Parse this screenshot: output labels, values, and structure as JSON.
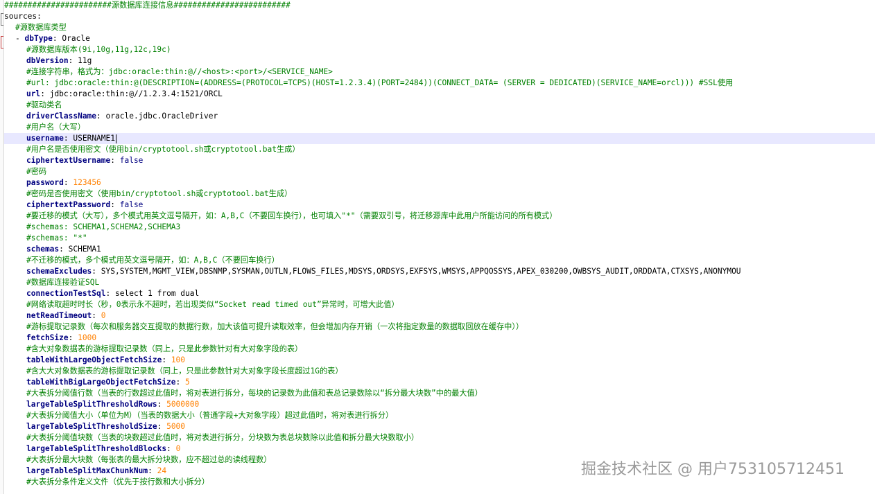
{
  "editor": {
    "lines": [
      {
        "type": "comment",
        "indent": 0,
        "text": "#######################源数据库连接信息#########################"
      },
      {
        "type": "kv",
        "indent": 0,
        "key": "sources",
        "val": "",
        "keyStyle": "plain"
      },
      {
        "type": "comment",
        "indent": 1,
        "text": "#源数据库类型"
      },
      {
        "type": "kv",
        "indent": 1,
        "dash": true,
        "key": "dbType",
        "val": "Oracle",
        "keyStyle": "bold"
      },
      {
        "type": "comment",
        "indent": 2,
        "text": "#源数据库版本(9i,10g,11g,12c,19c)"
      },
      {
        "type": "kv",
        "indent": 2,
        "key": "dbVersion",
        "val": "11g",
        "keyStyle": "bold"
      },
      {
        "type": "comment",
        "indent": 2,
        "text": "#连接字符串，格式为：jdbc:oracle:thin:@//<host>:<port>/<SERVICE_NAME>"
      },
      {
        "type": "comment",
        "indent": 2,
        "text": "#url: jdbc:oracle:thin:@(DESCRIPTION=(ADDRESS=(PROTOCOL=TCPS)(HOST=1.2.3.4)(PORT=2484))(CONNECT_DATA= (SERVER = DEDICATED)(SERVICE_NAME=orcl))) #SSL使用"
      },
      {
        "type": "kv",
        "indent": 2,
        "key": "url",
        "val": "jdbc:oracle:thin:@//1.2.3.4:1521/ORCL",
        "keyStyle": "bold"
      },
      {
        "type": "comment",
        "indent": 2,
        "text": "#驱动类名"
      },
      {
        "type": "kv",
        "indent": 2,
        "key": "driverClassName",
        "val": "oracle.jdbc.OracleDriver",
        "keyStyle": "bold"
      },
      {
        "type": "comment",
        "indent": 2,
        "text": "#用户名（大写）"
      },
      {
        "type": "kv",
        "indent": 2,
        "key": "username",
        "val": "USERNAME1",
        "keyStyle": "bold",
        "current": true
      },
      {
        "type": "comment",
        "indent": 2,
        "text": "#用户名是否使用密文（使用bin/cryptotool.sh或cryptotool.bat生成）"
      },
      {
        "type": "kv",
        "indent": 2,
        "key": "ciphertextUsername",
        "val": "false",
        "keyStyle": "bold",
        "valStyle": "bool"
      },
      {
        "type": "comment",
        "indent": 2,
        "text": "#密码"
      },
      {
        "type": "kv",
        "indent": 2,
        "key": "password",
        "val": "123456",
        "keyStyle": "bold",
        "valStyle": "num"
      },
      {
        "type": "comment",
        "indent": 2,
        "text": "#密码是否使用密文（使用bin/cryptotool.sh或cryptotool.bat生成）"
      },
      {
        "type": "kv",
        "indent": 2,
        "key": "ciphertextPassword",
        "val": "false",
        "keyStyle": "bold",
        "valStyle": "bool"
      },
      {
        "type": "comment",
        "indent": 2,
        "text": "#要迁移的模式（大写），多个模式用英文逗号隔开，如：A,B,C（不要回车换行），也可填入\"*\"（需要双引号，将迁移源库中此用户所能访问的所有模式）"
      },
      {
        "type": "comment",
        "indent": 2,
        "text": "#schemas: SCHEMA1,SCHEMA2,SCHEMA3"
      },
      {
        "type": "comment",
        "indent": 2,
        "text": "#schemas: \"*\""
      },
      {
        "type": "kv",
        "indent": 2,
        "key": "schemas",
        "val": "SCHEMA1",
        "keyStyle": "bold"
      },
      {
        "type": "comment",
        "indent": 2,
        "text": "#不迁移的模式，多个模式用英文逗号隔开，如：A,B,C（不要回车换行）"
      },
      {
        "type": "kv",
        "indent": 2,
        "key": "schemaExcludes",
        "val": "SYS,SYSTEM,MGMT_VIEW,DBSNMP,SYSMAN,OUTLN,FLOWS_FILES,MDSYS,ORDSYS,EXFSYS,WMSYS,APPQOSSYS,APEX_030200,OWBSYS_AUDIT,ORDDATA,CTXSYS,ANONYMOU",
        "keyStyle": "bold"
      },
      {
        "type": "comment",
        "indent": 2,
        "text": "#数据库连接验证SQL"
      },
      {
        "type": "kv",
        "indent": 2,
        "key": "connectionTestSql",
        "val": "select 1 from dual",
        "keyStyle": "bold"
      },
      {
        "type": "comment",
        "indent": 2,
        "text": "#网络读取超时时长（秒，0表示永不超时，若出现类似“Socket read timed out”异常时，可增大此值）"
      },
      {
        "type": "kv",
        "indent": 2,
        "key": "netReadTimeout",
        "val": "0",
        "keyStyle": "bold",
        "valStyle": "num"
      },
      {
        "type": "comment",
        "indent": 2,
        "text": "#游标提取记录数（每次和服务器交互提取的数据行数，加大该值可提升读取效率，但会增加内存开销（一次将指定数量的数据取回放在缓存中））"
      },
      {
        "type": "kv",
        "indent": 2,
        "key": "fetchSize",
        "val": "1000",
        "keyStyle": "bold",
        "valStyle": "num"
      },
      {
        "type": "comment",
        "indent": 2,
        "text": "#含大对象数据表的游标提取记录数（同上，只是此参数针对有大对象字段的表）"
      },
      {
        "type": "kv",
        "indent": 2,
        "key": "tableWithLargeObjectFetchSize",
        "val": "100",
        "keyStyle": "bold",
        "valStyle": "num"
      },
      {
        "type": "comment",
        "indent": 2,
        "text": "#含大大对象数据表的游标提取记录数（同上，只是此参数针对大对象字段长度超过1G的表）"
      },
      {
        "type": "kv",
        "indent": 2,
        "key": "tableWithBigLargeObjectFetchSize",
        "val": "5",
        "keyStyle": "bold",
        "valStyle": "num"
      },
      {
        "type": "comment",
        "indent": 2,
        "text": "#大表拆分阈值行数（当表的行数超过此值时，将对表进行拆分，每块的记录数为此值和表总记录数除以“拆分最大块数”中的最大值）"
      },
      {
        "type": "kv",
        "indent": 2,
        "key": "largeTableSplitThresholdRows",
        "val": "5000000",
        "keyStyle": "bold",
        "valStyle": "num"
      },
      {
        "type": "comment",
        "indent": 2,
        "text": "#大表拆分阈值大小（单位为M）（当表的数据大小（普通字段+大对象字段）超过此值时，将对表进行拆分）"
      },
      {
        "type": "kv",
        "indent": 2,
        "key": "largeTableSplitThresholdSize",
        "val": "5000",
        "keyStyle": "bold",
        "valStyle": "num"
      },
      {
        "type": "comment",
        "indent": 2,
        "text": "#大表拆分阈值块数（当表的块数超过此值时，将对表进行拆分，分块数为表总块数除以此值和拆分最大块数取小）"
      },
      {
        "type": "kv",
        "indent": 2,
        "key": "largeTableSplitThresholdBlocks",
        "val": "0",
        "keyStyle": "bold",
        "valStyle": "num"
      },
      {
        "type": "comment",
        "indent": 2,
        "text": "#大表拆分最大块数（每张表的最大拆分块数，应不超过总的读线程数）"
      },
      {
        "type": "kv",
        "indent": 2,
        "key": "largeTableSplitMaxChunkNum",
        "val": "24",
        "keyStyle": "bold",
        "valStyle": "num"
      },
      {
        "type": "comment",
        "indent": 2,
        "text": "#大表拆分条件定义文件（优先于按行数和大小拆分）"
      }
    ]
  },
  "watermark": {
    "text": "掘金技术社区 @ 用户753105712451"
  },
  "colors": {
    "comment": "#008000",
    "key": "#000080",
    "number": "#ff8000",
    "current_line": "#e8e8ff"
  }
}
